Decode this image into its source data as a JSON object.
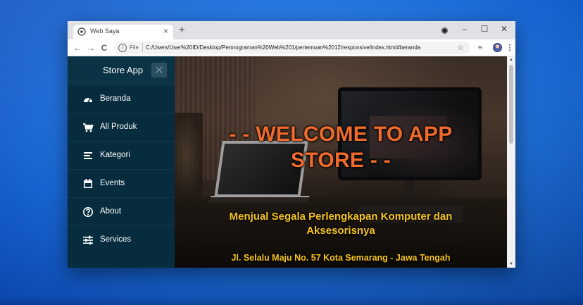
{
  "browser": {
    "tab_title": "Web Saya",
    "tab_close": "×",
    "new_tab": "+",
    "window_controls": {
      "minimize": "–",
      "maximize": "☐",
      "close": "✕"
    },
    "nav": {
      "back": "←",
      "forward": "→",
      "reload": "C"
    },
    "address_bar": {
      "scheme_label": "File",
      "url": "C:/Users/User%20ID/Desktop/Pemrograman%20Web%201/pertemuan%2012/responsive/index.html#beranda"
    },
    "toolbar_icons": [
      "star-icon",
      "reading-list-icon",
      "avatar",
      "menu-icon"
    ],
    "menu_glyph": "⋮",
    "star_glyph": "☆",
    "reading_list_glyph": "≡"
  },
  "sidebar": {
    "title": "Store App",
    "close_glyph": "✕",
    "items": [
      {
        "label": "Beranda",
        "icon": "tachometer-icon"
      },
      {
        "label": "All Produk",
        "icon": "cart-icon"
      },
      {
        "label": "Kategori",
        "icon": "list-icon"
      },
      {
        "label": "Events",
        "icon": "calendar-icon"
      },
      {
        "label": "About",
        "icon": "question-circle-icon"
      },
      {
        "label": "Services",
        "icon": "sliders-icon"
      }
    ]
  },
  "hero": {
    "title": "- - WELCOME TO APP STORE - -",
    "subtitle": "Menjual Segala Perlengkapan Komputer dan Aksesorisnya",
    "address": "Jl. Selalu Maju No. 57 Kota Semarang - Jawa Tengah"
  },
  "colors": {
    "sidebar_bg": "#062c3d",
    "title_orange": "#ef6a2c",
    "text_yellow": "#f6c51f",
    "desktop_blue": "#1f72de"
  }
}
